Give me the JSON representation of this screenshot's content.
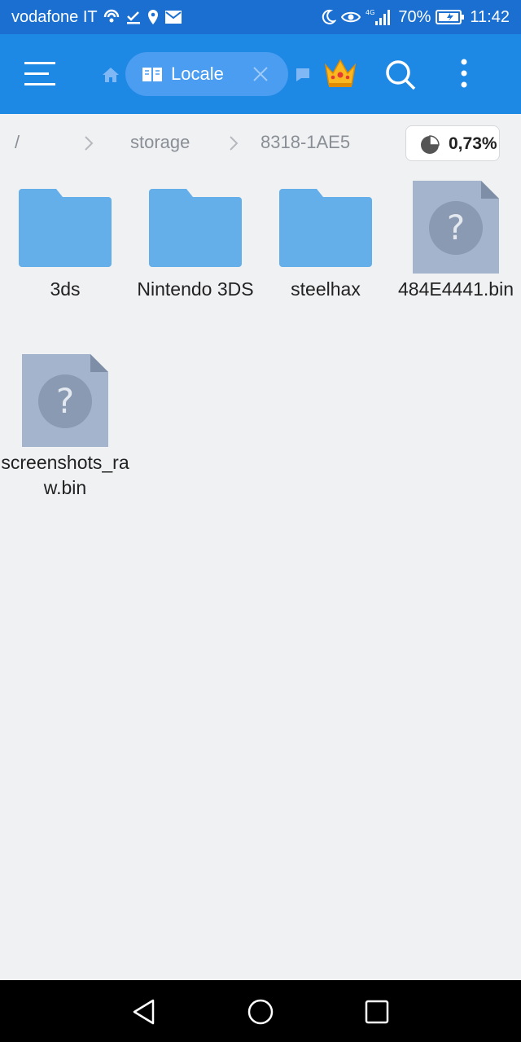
{
  "status_bar": {
    "carrier": "vodafone IT",
    "network": "4G",
    "battery": "70%",
    "time": "11:42"
  },
  "app_bar": {
    "tab_label": "Locale"
  },
  "breadcrumb": {
    "root": "/",
    "segments": [
      "storage",
      "8318-1AE5"
    ],
    "storage_used": "0,73%"
  },
  "items": [
    {
      "name": "3ds",
      "type": "folder"
    },
    {
      "name": "Nintendo 3DS",
      "type": "folder"
    },
    {
      "name": "steelhax",
      "type": "folder"
    },
    {
      "name": "484E4441.bin",
      "type": "unknown-file"
    },
    {
      "name": "screenshots_raw.bin",
      "type": "unknown-file"
    }
  ],
  "colors": {
    "status_bar": "#1a6fd1",
    "app_bar": "#1e88e5",
    "chip": "#4a9df0",
    "folder": "#64afea",
    "file": "#a4b4cc",
    "background": "#f0f1f3"
  }
}
